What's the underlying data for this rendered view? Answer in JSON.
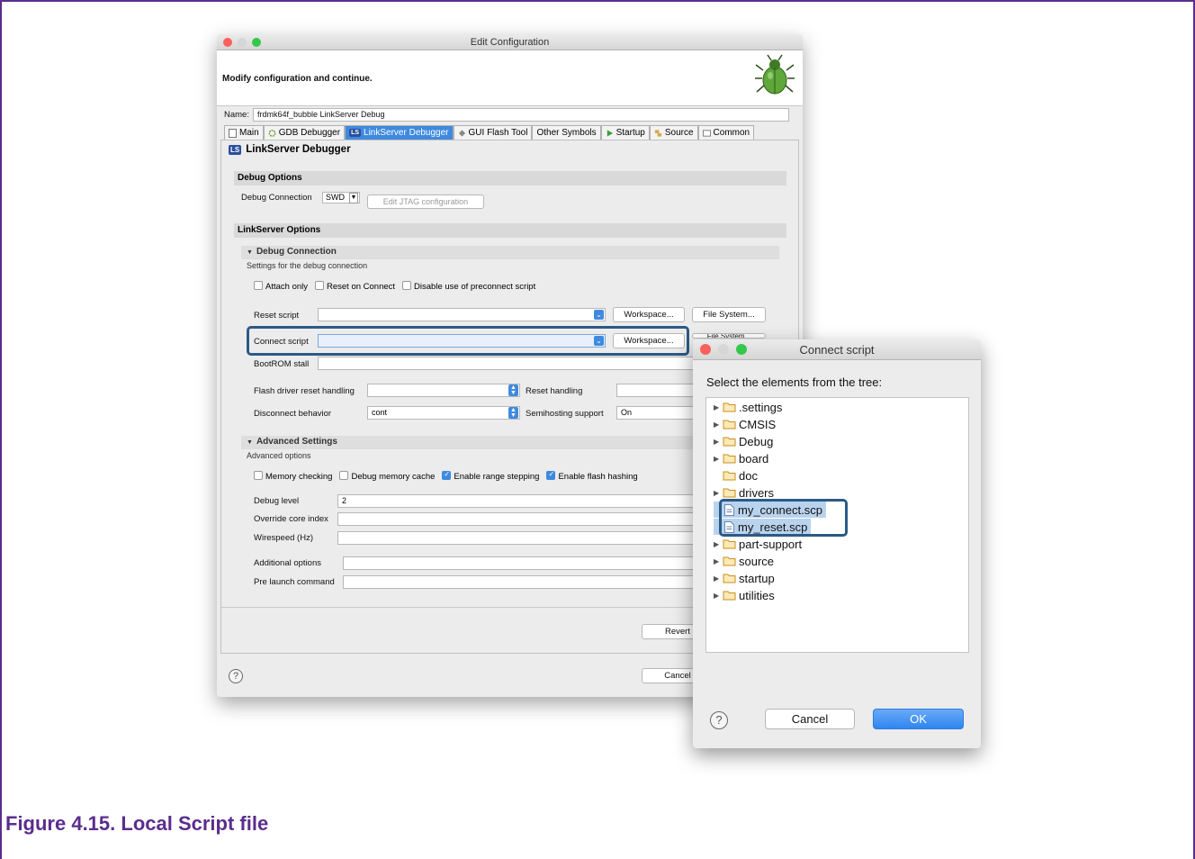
{
  "main_dialog": {
    "title": "Edit Configuration",
    "banner_message": "Modify configuration and continue.",
    "name_label": "Name:",
    "name_value": "frdmk64f_bubble LinkServer Debug",
    "tabs": [
      {
        "label": "Main"
      },
      {
        "label": "GDB Debugger"
      },
      {
        "label": "LinkServer Debugger"
      },
      {
        "label": "GUI Flash Tool"
      },
      {
        "label": "Other Symbols"
      },
      {
        "label": "Startup"
      },
      {
        "label": "Source"
      },
      {
        "label": "Common"
      }
    ],
    "panel_title": "LinkServer Debugger",
    "panel_badge": "LS",
    "debug_options": {
      "section": "Debug Options",
      "connection_label": "Debug Connection",
      "connection_value": "SWD",
      "edit_jtag_button": "Edit JTAG configuration"
    },
    "linkserver_options": {
      "section": "LinkServer Options",
      "debug_connection_sub": "Debug Connection",
      "debug_connection_desc": "Settings for the debug connection",
      "attach_only": "Attach only",
      "reset_on_connect": "Reset on Connect",
      "disable_preconnect": "Disable use of preconnect script",
      "reset_script_label": "Reset script",
      "connect_script_label": "Connect script",
      "workspace_button": "Workspace...",
      "file_system_button": "File System...",
      "file_system_button_partial": "File System...",
      "bootrom_label": "BootROM stall",
      "flash_reset_label": "Flash driver reset handling",
      "reset_handling_label": "Reset handling",
      "disconnect_label": "Disconnect behavior",
      "disconnect_value": "cont",
      "semihosting_label": "Semihosting support",
      "semihosting_value": "On"
    },
    "advanced": {
      "section": "Advanced Settings",
      "desc": "Advanced options",
      "memory_checking": "Memory checking",
      "debug_memory_cache": "Debug memory cache",
      "enable_range_stepping": "Enable range stepping",
      "enable_flash_hashing": "Enable flash hashing",
      "debug_level_label": "Debug level",
      "debug_level_value": "2",
      "override_core_label": "Override core index",
      "wirespeed_label": "Wirespeed (Hz)",
      "additional_options_label": "Additional options",
      "pre_launch_label": "Pre launch command"
    },
    "revert_button": "Revert",
    "cancel_button": "Cancel",
    "help_glyph": "?"
  },
  "connect_dialog": {
    "title": "Connect script",
    "message": "Select the elements from the tree:",
    "tree": [
      {
        "label": ".settings",
        "type": "folder",
        "expandable": true
      },
      {
        "label": "CMSIS",
        "type": "folder",
        "expandable": true
      },
      {
        "label": "Debug",
        "type": "folder",
        "expandable": true
      },
      {
        "label": "board",
        "type": "folder",
        "expandable": true
      },
      {
        "label": "doc",
        "type": "folder",
        "expandable": false
      },
      {
        "label": "drivers",
        "type": "folder",
        "expandable": true
      },
      {
        "label": "my_connect.scp",
        "type": "file",
        "selected": true
      },
      {
        "label": "my_reset.scp",
        "type": "file",
        "selected": true
      },
      {
        "label": "part-support",
        "type": "folder",
        "expandable": true
      },
      {
        "label": "source",
        "type": "folder",
        "expandable": true
      },
      {
        "label": "startup",
        "type": "folder",
        "expandable": true
      },
      {
        "label": "utilities",
        "type": "folder",
        "expandable": true
      }
    ],
    "cancel_button": "Cancel",
    "ok_button": "OK",
    "help_glyph": "?"
  },
  "caption": "Figure 4.15. Local Script file",
  "colors": {
    "accent_blue": "#3f8ade",
    "highlight_border": "#2b5a86",
    "caption_purple": "#5b2d8e"
  }
}
